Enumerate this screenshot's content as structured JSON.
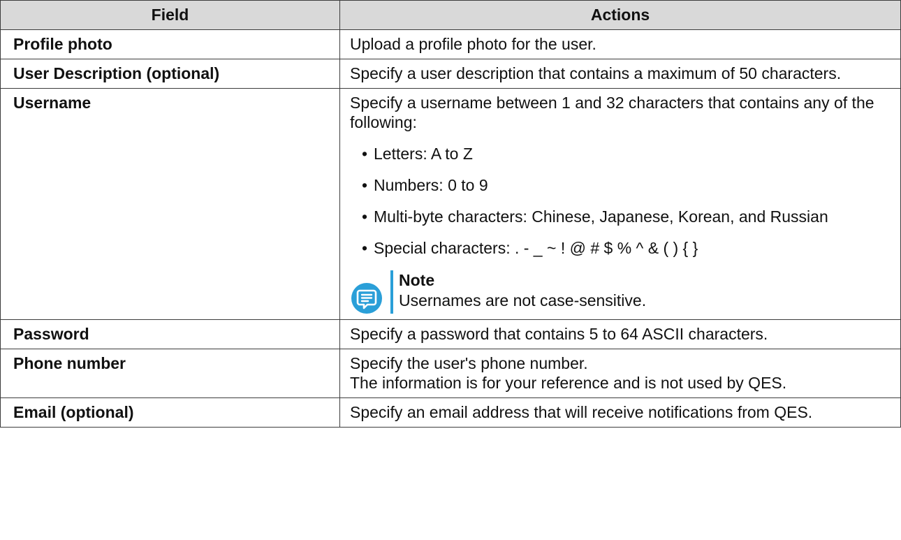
{
  "header": {
    "field": "Field",
    "actions": "Actions"
  },
  "rows": [
    {
      "field": "Profile photo",
      "lines": [
        "Upload a profile photo for the user."
      ]
    },
    {
      "field": "User Description (optional)",
      "lines": [
        "Specify a user description that contains a maximum of 50 characters."
      ]
    },
    {
      "field": "Username",
      "lines": [
        "Specify a username between 1 and 32 characters that contains any of the following:"
      ],
      "items": [
        "Letters: A to Z",
        "Numbers: 0 to 9",
        "Multi-byte characters: Chinese, Japanese, Korean, and Russian",
        "Special characters: . - _ ~ ! @ # $ % ^ & ( ) { }"
      ],
      "note": {
        "title": "Note",
        "text": "Usernames are not case-sensitive.",
        "icon": "note-icon"
      }
    },
    {
      "field": "Password",
      "lines": [
        "Specify a password that contains 5 to 64 ASCII characters."
      ]
    },
    {
      "field": "Phone number",
      "lines": [
        "Specify the user's phone number.",
        "The information is for your reference and is not used by QES."
      ]
    },
    {
      "field": "Email (optional)",
      "lines": [
        "Specify an email address that will receive notifications from QES."
      ]
    }
  ],
  "colors": {
    "header_bg": "#d9d9d9",
    "border": "#3c3c3c",
    "note_accent": "#2a9fd8"
  }
}
